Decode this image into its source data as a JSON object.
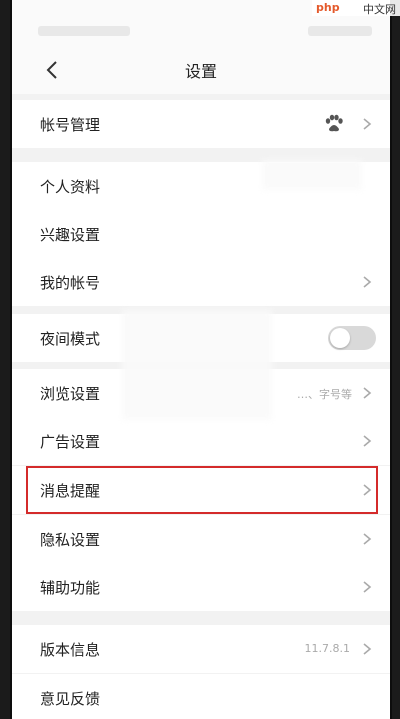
{
  "nav": {
    "title": "设置",
    "back_icon": "chevron-left-icon"
  },
  "settings": {
    "account_management": {
      "label": "帐号管理",
      "icon": "paw-icon"
    },
    "personal_profile": {
      "label": "个人资料"
    },
    "interest_settings": {
      "label": "兴趣设置"
    },
    "my_account": {
      "label": "我的帐号"
    },
    "night_mode": {
      "label": "夜间模式",
      "enabled": false
    },
    "browse_settings": {
      "label": "浏览设置",
      "value": "…、字号等"
    },
    "ad_settings": {
      "label": "广告设置"
    },
    "message_reminder": {
      "label": "消息提醒",
      "highlighted": true
    },
    "privacy_settings": {
      "label": "隐私设置"
    },
    "accessibility": {
      "label": "辅助功能"
    },
    "version_info": {
      "label": "版本信息",
      "value": "11.7.8.1"
    },
    "feedback": {
      "label": "意见反馈"
    }
  },
  "watermark": {
    "logo": "php",
    "text": "中文网"
  },
  "colors": {
    "highlight": "#d42b2b",
    "background": "#f2f2f2",
    "row": "#ffffff"
  }
}
